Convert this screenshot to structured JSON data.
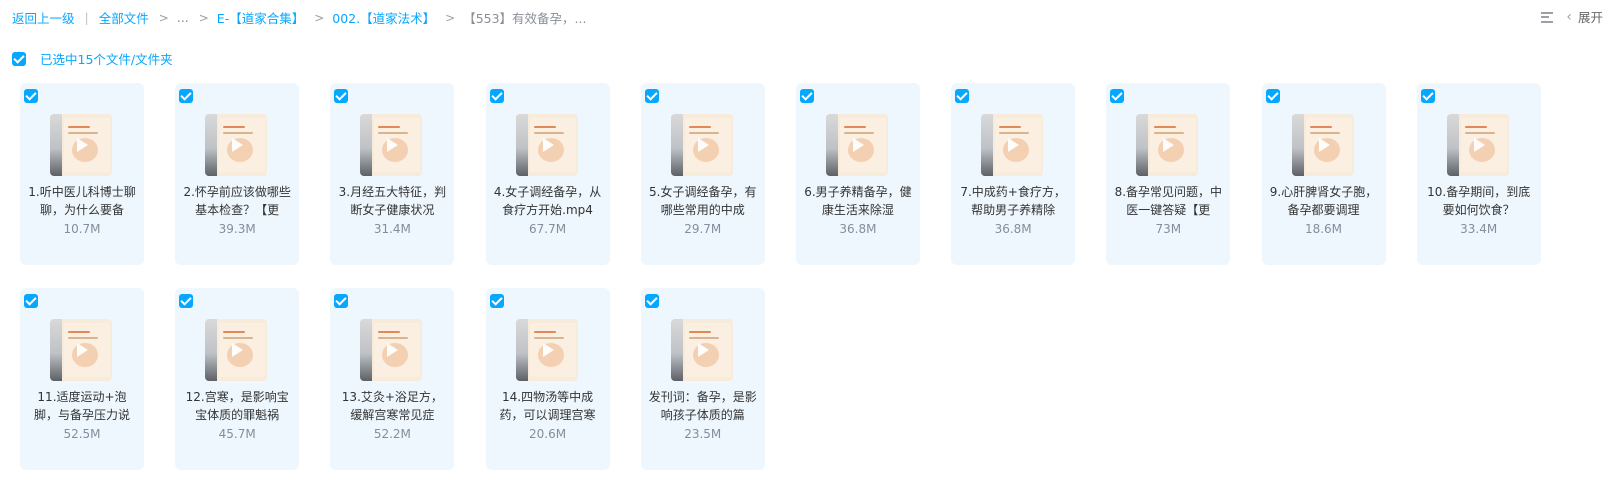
{
  "breadcrumb": {
    "back": "返回上一级",
    "separator": "|",
    "all_files": "全部文件",
    "arrow": ">",
    "ellipsis": "...",
    "level1": "E-【道家合集】",
    "level2": "002.【道家法术】",
    "current": "【553】有效备孕，..."
  },
  "toolbar": {
    "expand_label": "展开",
    "list_icon": "list-icon",
    "chevron_icon": "chevron-left-icon"
  },
  "selection": {
    "label": "已选中15个文件/文件夹"
  },
  "colors": {
    "accent": "#06a7ff",
    "card_bg": "#eef7fe",
    "size_text": "#878c9c"
  },
  "files": [
    {
      "name": "1.听中医儿科博士聊聊，为什么要备",
      "size": "10.7M"
    },
    {
      "name": "2.怀孕前应该做哪些基本检查？【更",
      "size": "39.3M"
    },
    {
      "name": "3.月经五大特征，判断女子健康状况",
      "size": "31.4M"
    },
    {
      "name": "4.女子调经备孕，从食疗方开始.mp4",
      "size": "67.7M"
    },
    {
      "name": "5.女子调经备孕，有哪些常用的中成",
      "size": "29.7M"
    },
    {
      "name": "6.男子养精备孕，健康生活来除湿",
      "size": "36.8M"
    },
    {
      "name": "7.中成药+食疗方，帮助男子养精除",
      "size": "36.8M"
    },
    {
      "name": "8.备孕常见问题，中医一键答疑【更",
      "size": "73M"
    },
    {
      "name": "9.心肝脾肾女子胞，备孕都要调理",
      "size": "18.6M"
    },
    {
      "name": "10.备孕期间，到底要如何饮食？",
      "size": "33.4M"
    },
    {
      "name": "11.适度运动+泡脚，与备孕压力说",
      "size": "52.5M"
    },
    {
      "name": "12.宫寒，是影响宝宝体质的罪魁祸",
      "size": "45.7M"
    },
    {
      "name": "13.艾灸+浴足方，缓解宫寒常见症",
      "size": "52.2M"
    },
    {
      "name": "14.四物汤等中成药，可以调理宫寒",
      "size": "20.6M"
    },
    {
      "name": "发刊词：备孕，是影响孩子体质的篇",
      "size": "23.5M"
    }
  ]
}
